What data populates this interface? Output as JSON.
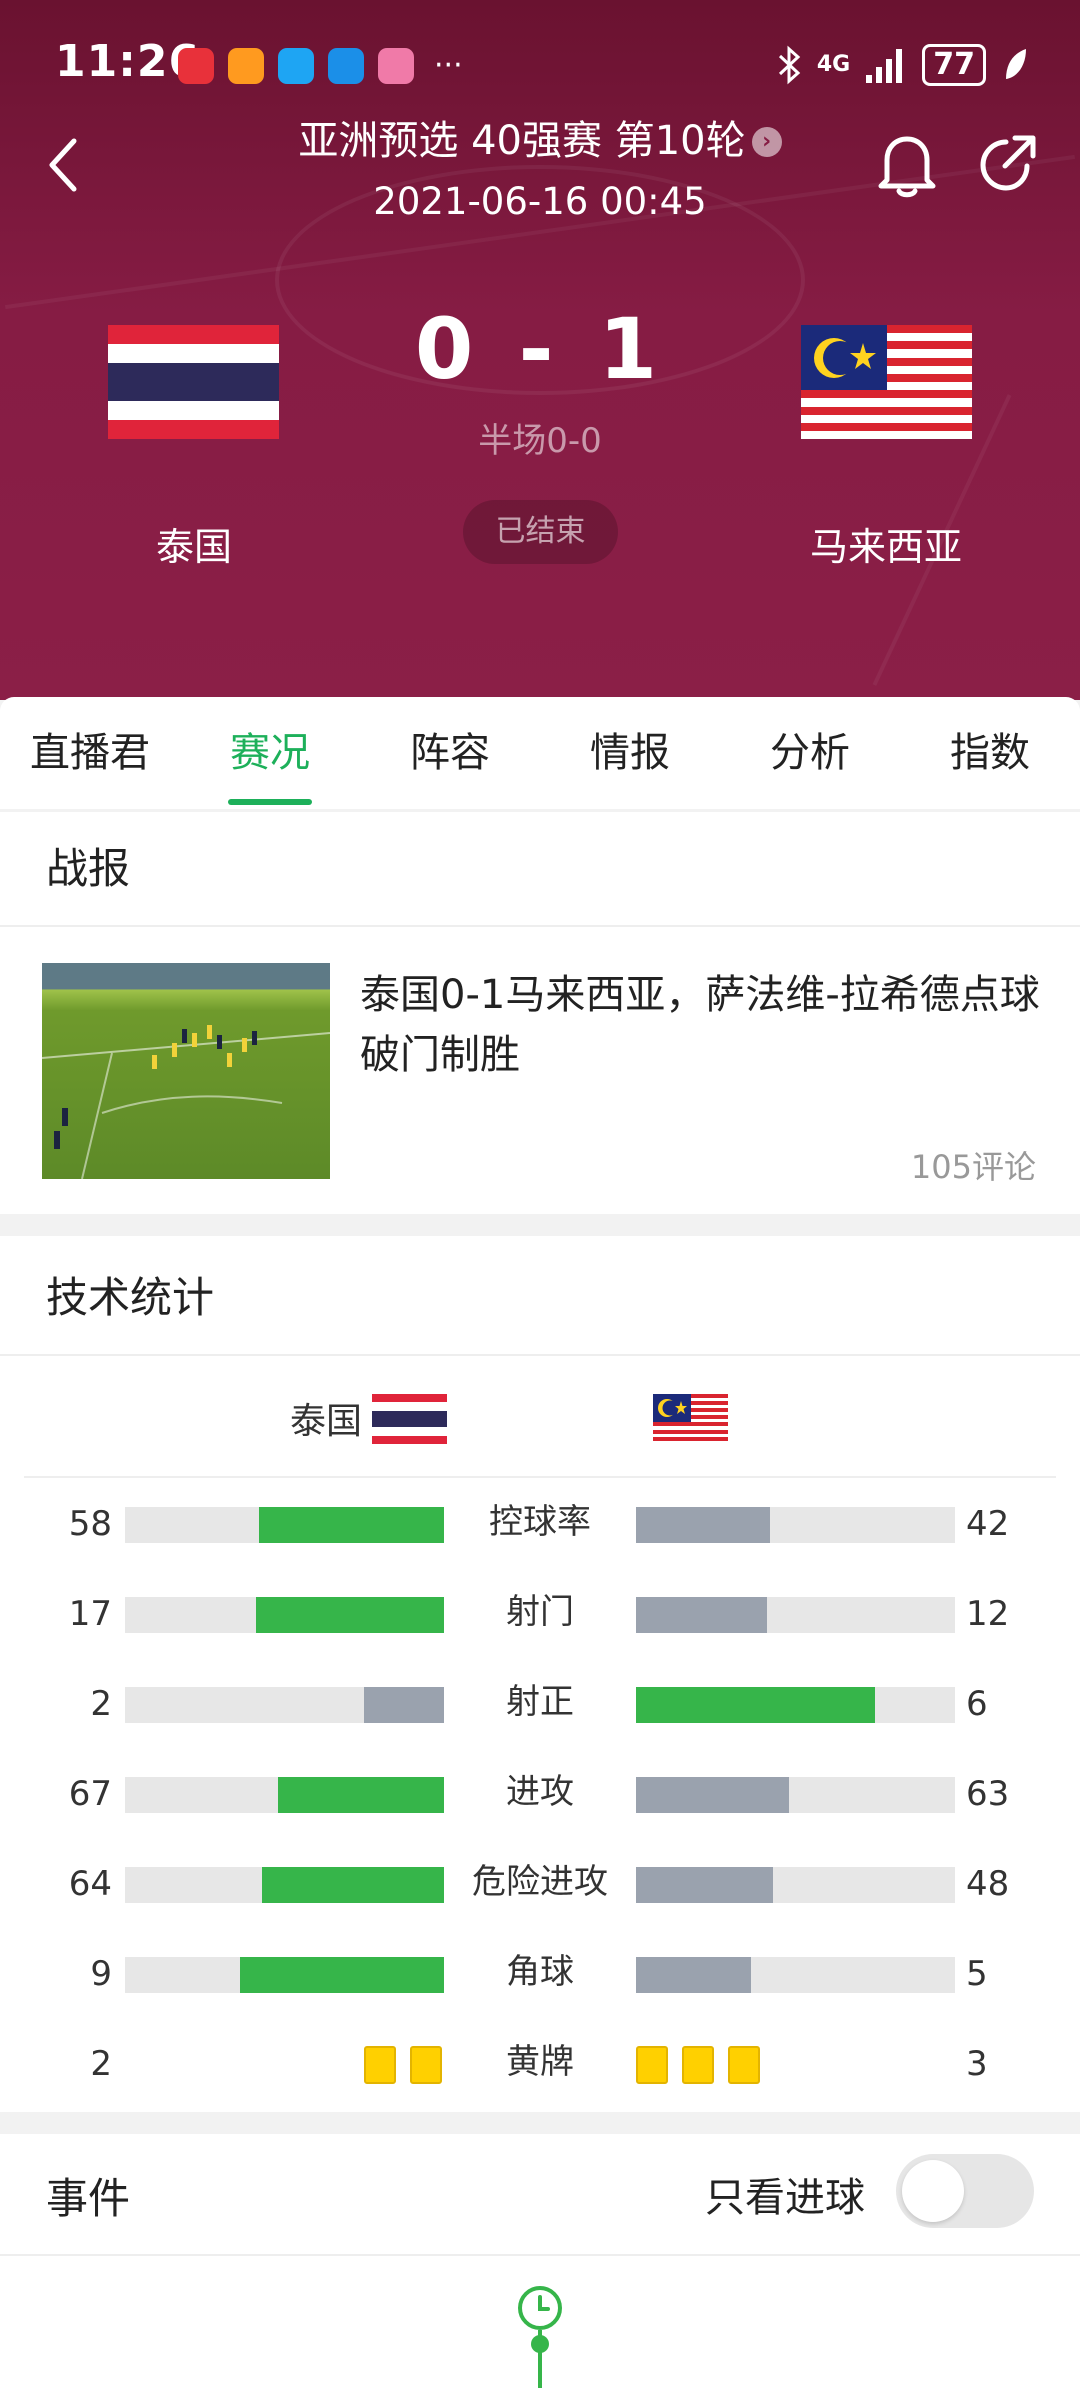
{
  "statusbar": {
    "time": "11:26",
    "more": "···",
    "network": "4G",
    "battery": "77",
    "app_colors": [
      "#e8313a",
      "#ff9a1f",
      "#1ea5f3",
      "#1b8fe8",
      "#f07aa8"
    ]
  },
  "header": {
    "league": "亚洲预选 40强赛 第10轮",
    "datetime": "2021-06-16 00:45",
    "score": "0 - 1",
    "halftime": "半场0-0",
    "status": "已结束",
    "home_team": "泰国",
    "away_team": "马来西亚",
    "bg_color": "#861c44"
  },
  "tabs": [
    {
      "label": "直播君",
      "active": false
    },
    {
      "label": "赛况",
      "active": true
    },
    {
      "label": "阵容",
      "active": false
    },
    {
      "label": "情报",
      "active": false
    },
    {
      "label": "分析",
      "active": false
    },
    {
      "label": "指数",
      "active": false
    }
  ],
  "report": {
    "title": "战报",
    "headline": "泰国0-1马来西亚，萨法维-拉希德点球破门制胜",
    "comments": "105评论"
  },
  "stats": {
    "title": "技术统计",
    "home": "泰国",
    "away": "马来西亚",
    "win_color": "#36b54a",
    "lose_color": "#9aa2ae",
    "rows": [
      {
        "label": "控球率",
        "home": "58",
        "away": "42",
        "home_frac": 0.58,
        "away_frac": 0.42
      },
      {
        "label": "射门",
        "home": "17",
        "away": "12",
        "home_frac": 0.59,
        "away_frac": 0.41
      },
      {
        "label": "射正",
        "home": "2",
        "away": "6",
        "home_frac": 0.25,
        "away_frac": 0.75
      },
      {
        "label": "进攻",
        "home": "67",
        "away": "63",
        "home_frac": 0.52,
        "away_frac": 0.48
      },
      {
        "label": "危险进攻",
        "home": "64",
        "away": "48",
        "home_frac": 0.57,
        "away_frac": 0.43
      },
      {
        "label": "角球",
        "home": "9",
        "away": "5",
        "home_frac": 0.64,
        "away_frac": 0.36
      },
      {
        "label": "黄牌",
        "home": "2",
        "away": "3",
        "home_cards": 2,
        "away_cards": 3
      }
    ]
  },
  "events": {
    "title": "事件",
    "goals_only_label": "只看进球",
    "goals_only": false
  }
}
